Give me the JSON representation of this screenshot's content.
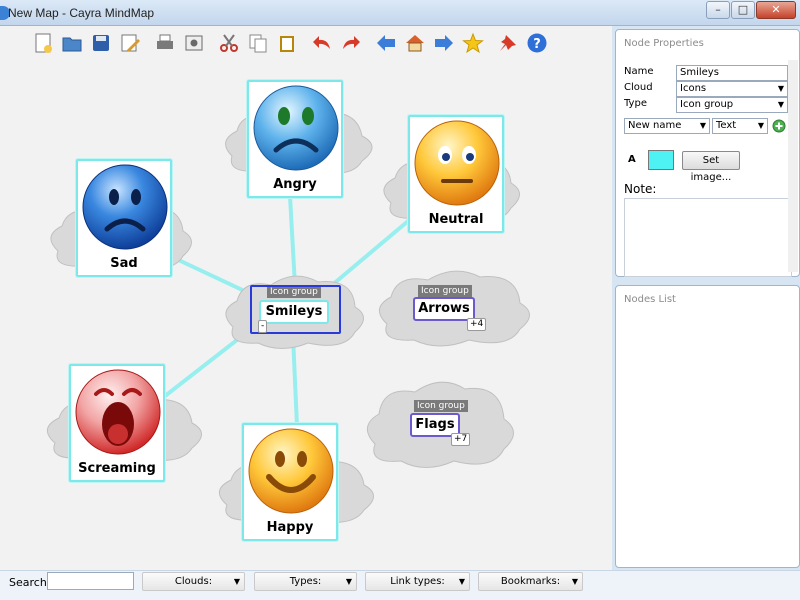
{
  "window": {
    "title": "New Map - Cayra MindMap",
    "minimize": "–",
    "maximize": "□",
    "close": "✕"
  },
  "toolbar": {
    "buttons": [
      {
        "name": "new-map",
        "icon": "new-document-icon",
        "color": "#f5c84a"
      },
      {
        "name": "open-map",
        "icon": "open-folder-icon",
        "color": "#4a86c8"
      },
      {
        "name": "save-map",
        "icon": "floppy-disk-icon",
        "color": "#2f5fa8"
      },
      {
        "name": "edit",
        "icon": "pencil-icon",
        "color": "#d99a2b"
      },
      {
        "name": "print",
        "icon": "printer-icon",
        "color": "#7a7a7a"
      },
      {
        "name": "export-image",
        "icon": "camera-icon",
        "color": "#6a6a6a"
      },
      {
        "name": "cut",
        "icon": "scissors-icon",
        "color": "#c0392b"
      },
      {
        "name": "copy",
        "icon": "copy-icon",
        "color": "#888888"
      },
      {
        "name": "paste",
        "icon": "clipboard-icon",
        "color": "#b8860b"
      },
      {
        "name": "undo",
        "icon": "undo-arrow-icon",
        "color": "#d83a2a"
      },
      {
        "name": "redo",
        "icon": "redo-arrow-icon",
        "color": "#d83a2a"
      },
      {
        "name": "back",
        "icon": "left-arrow-icon",
        "color": "#3b7dd8"
      },
      {
        "name": "home",
        "icon": "home-icon",
        "color": "#d9602a"
      },
      {
        "name": "forward",
        "icon": "right-arrow-icon",
        "color": "#3b7dd8"
      },
      {
        "name": "favorite",
        "icon": "star-icon",
        "color": "#f5c518"
      },
      {
        "name": "pin",
        "icon": "pushpin-icon",
        "color": "#d83a2a"
      },
      {
        "name": "help",
        "icon": "help-icon",
        "color": "#2f6fd8"
      }
    ]
  },
  "map": {
    "link_color": "#8eeeee",
    "node_border_color": "#7de8ea",
    "center": {
      "group_tag": "Icon group",
      "label": "Smileys",
      "collapse": "-"
    },
    "nodes": [
      {
        "id": "angry",
        "label": "Angry",
        "face": "angry",
        "color": "#2f8fd6"
      },
      {
        "id": "neutral",
        "label": "Neutral",
        "face": "neutral",
        "color": "#f5a623"
      },
      {
        "id": "sad",
        "label": "Sad",
        "face": "sad",
        "color": "#1f5fc8"
      },
      {
        "id": "screaming",
        "label": "Screaming",
        "face": "screaming",
        "color": "#e04848"
      },
      {
        "id": "happy",
        "label": "Happy",
        "face": "happy",
        "color": "#f5a623"
      }
    ],
    "groups": [
      {
        "id": "arrows",
        "group_tag": "Icon group",
        "label": "Arrows",
        "badge": "+4"
      },
      {
        "id": "flags",
        "group_tag": "Icon group",
        "label": "Flags",
        "badge": "+7"
      }
    ]
  },
  "statusbar": {
    "search_label": "Search:",
    "search_value": "",
    "clouds": "Clouds:",
    "types": "Types:",
    "link_types": "Link types:",
    "bookmarks": "Bookmarks:",
    "arrow": "▼"
  },
  "node_properties": {
    "title": "Node Properties",
    "name_label": "Name",
    "name_value": "Smileys",
    "cloud_label": "Cloud",
    "cloud_value": "Icons",
    "type_label": "Type",
    "type_value": "Icon group",
    "new_name": "New name",
    "text_type": "Text",
    "font_label": "A",
    "swatch_color": "#4ef2f2",
    "set_image": "Set image...",
    "note_label": "Note:",
    "note_value": ""
  },
  "nodes_list": {
    "title": "Nodes List"
  }
}
